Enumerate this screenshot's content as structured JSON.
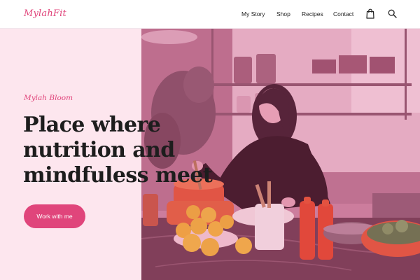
{
  "header": {
    "logo": "MylahFit",
    "nav": [
      "My Story",
      "Shop",
      "Recipes",
      "Contact"
    ],
    "icons": [
      "shopping-bag-icon",
      "search-icon"
    ]
  },
  "hero": {
    "eyebrow": "Mylah Bloom",
    "headline_lines": [
      "Place where",
      "nutrition and",
      "mindfuless meet"
    ],
    "cta_label": "Work with me",
    "photo": {
      "subject": "woman cooking in a kitchen",
      "overlay_color": "#e0457b"
    }
  },
  "colors": {
    "accent": "#e0457b",
    "panel_bg": "#fde6ee",
    "text_dark": "#1d1d1d"
  }
}
